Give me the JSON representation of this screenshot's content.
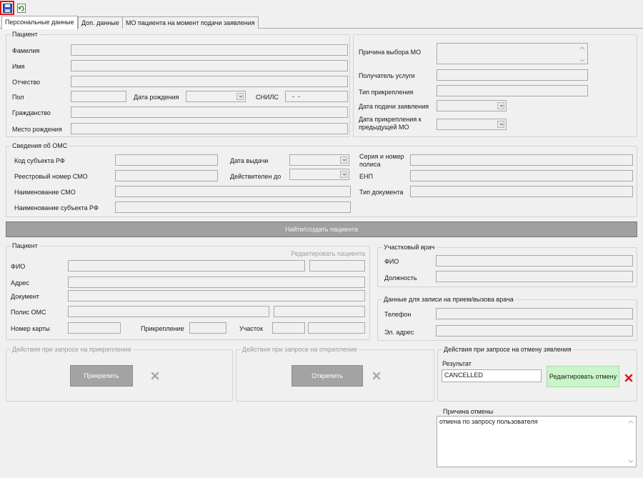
{
  "toolbar": {
    "save_icon": "floppy-disk-icon",
    "refresh_icon": "refresh-icon"
  },
  "tabs": [
    {
      "label": "Персональные данные"
    },
    {
      "label": "Доп. данные"
    },
    {
      "label": "МО пациента на момент подачи заявления"
    }
  ],
  "patient": {
    "legend": "Пациент",
    "last_name_label": "Фамилия",
    "first_name_label": "Имя",
    "middle_name_label": "Отчество",
    "sex_label": "Пол",
    "birth_date_label": "Дата рождения",
    "snils_label": "СНИЛС",
    "snils_value": "  -  -",
    "citizenship_label": "Гражданство",
    "birth_place_label": "Место рождения"
  },
  "mo_choice": {
    "reason_label": "Причина выбора МО",
    "recipient_label": "Получатель услуги",
    "attach_type_label": "Тип прикрепления",
    "submit_date_label": "Дата подачи заявления",
    "prev_attach_date_label": "Дата прикрепления к предыдущей МО"
  },
  "oms": {
    "legend": "Сведения об ОМС",
    "subject_code_label": "Код субъекта РФ",
    "registry_smo_label": "Реестровый номер СМО",
    "smo_name_label": "Наименование СМО",
    "subject_name_label": "Наименование субъекта РФ",
    "issue_date_label": "Дата выдачи",
    "valid_until_label": "Действителен до",
    "policy_series_label": "Серия и номер полиса",
    "enp_label": "ЕНП",
    "doc_type_label": "Тип документа"
  },
  "find_button": "Найти/создать пациента",
  "patient2": {
    "legend": "Пациент",
    "edit_link": "Редактировать пациента",
    "fio_label": "ФИО",
    "address_label": "Адрес",
    "document_label": "Документ",
    "policy_label": "Полис ОМС",
    "card_label": "Номер карты",
    "attach_label": "Прикрепление",
    "district_label": "Участок"
  },
  "doctor": {
    "legend": "Участковый врач",
    "fio_label": "ФИО",
    "position_label": "Должность"
  },
  "appointment": {
    "legend": "Данные для записи на прием/вызова врача",
    "phone_label": "Телефон",
    "email_label": "Эл. адрес"
  },
  "attach_actions": {
    "legend": "Действия при запросе на прикрепление",
    "button": "Прикрепить"
  },
  "detach_actions": {
    "legend": "Действия при запросе на открепление",
    "button": "Открепить"
  },
  "cancel_actions": {
    "legend": "Действия при запросе на отмену зявления",
    "result_label": "Результат",
    "result_value": "CANCELLED",
    "edit_button": "Редактировать отмену",
    "reason_label": "Причина отмены",
    "reason_value": "отмена по запросу пользователя"
  },
  "colors": {
    "accent_red": "#e01515",
    "green_button": "#c9f5c9"
  }
}
